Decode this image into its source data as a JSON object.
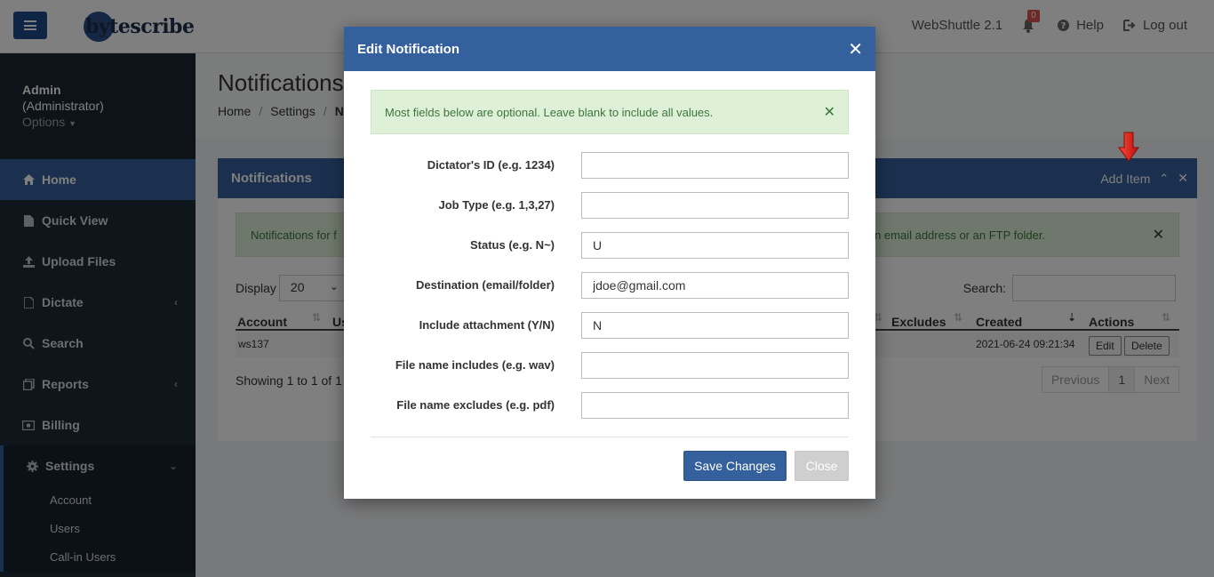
{
  "topbar": {
    "logo_text": "bytescribe",
    "app_version": "WebShuttle 2.1",
    "notification_count": "0",
    "help_label": "Help",
    "logout_label": "Log out"
  },
  "sidebar": {
    "user_name": "Admin",
    "user_role": "(Administrator)",
    "options_label": "Options",
    "items": [
      {
        "label": "Home"
      },
      {
        "label": "Quick View"
      },
      {
        "label": "Upload Files"
      },
      {
        "label": "Dictate"
      },
      {
        "label": "Search"
      },
      {
        "label": "Reports"
      },
      {
        "label": "Billing"
      },
      {
        "label": "Settings"
      }
    ],
    "settings_sub": [
      {
        "label": "Account"
      },
      {
        "label": "Users"
      },
      {
        "label": "Call-in Users"
      }
    ]
  },
  "page": {
    "title": "Notifications",
    "breadcrumb": [
      "Home",
      "Settings",
      "N"
    ]
  },
  "panel": {
    "title": "Notifications",
    "add_item_label": "Add Item",
    "alert_left": "Notifications for f",
    "alert_right": "e an email address or an FTP folder.",
    "display_label": "Display",
    "display_value": "20",
    "search_label": "Search:",
    "columns": {
      "account": "Account",
      "user_partial": "Us",
      "excludes": "Excludes",
      "created": "Created",
      "actions": "Actions"
    },
    "row": {
      "account": "ws137",
      "created": "2021-06-24 09:21:34",
      "edit_label": "Edit",
      "delete_label": "Delete"
    },
    "showing_text": "Showing 1 to 1 of 1 e",
    "pager": {
      "previous": "Previous",
      "page": "1",
      "next": "Next"
    }
  },
  "modal": {
    "title": "Edit Notification",
    "alert": "Most fields below are optional. Leave blank to include all values.",
    "fields": [
      {
        "label": "Dictator's ID (e.g. 1234)",
        "value": ""
      },
      {
        "label": "Job Type (e.g. 1,3,27)",
        "value": ""
      },
      {
        "label": "Status (e.g. N~)",
        "value": "U"
      },
      {
        "label": "Destination (email/folder)",
        "value": "jdoe@gmail.com"
      },
      {
        "label": "Include attachment (Y/N)",
        "value": "N"
      },
      {
        "label": "File name includes (e.g. wav)",
        "value": ""
      },
      {
        "label": "File name excludes (e.g. pdf)",
        "value": ""
      }
    ],
    "save_label": "Save Changes",
    "close_label": "Close"
  },
  "colors": {
    "primary": "#34619d",
    "sidebar": "#1c2b36",
    "alert_bg": "#dff0d8",
    "alert_text": "#3c763d",
    "badge": "#d9534f",
    "arrow": "#e8211c"
  }
}
